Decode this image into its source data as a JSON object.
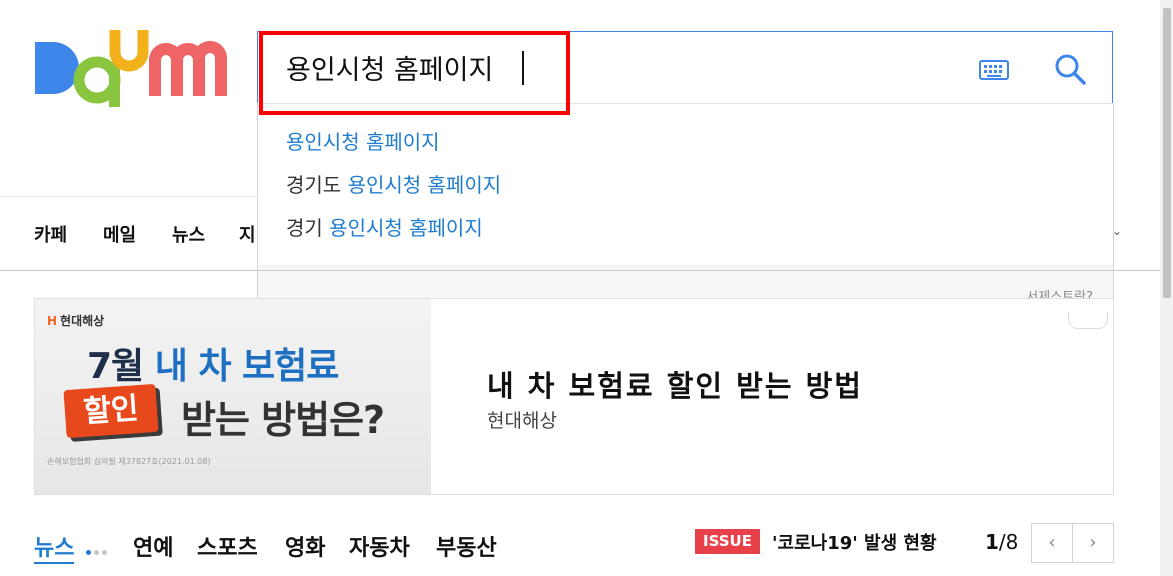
{
  "logo": {
    "text": "Daum",
    "colors": [
      "#3f86ea",
      "#f2b11b",
      "#8ac53f",
      "#f2b11b",
      "#ef6464"
    ]
  },
  "search": {
    "value": "용인시청 홈페이지",
    "keyboard_icon": "keyboard-icon",
    "search_icon": "magnifier-icon",
    "suggestions": [
      {
        "prefix": "",
        "match": "용인시청 홈페이지"
      },
      {
        "prefix": "경기도 ",
        "match": "용인시청 홈페이지"
      },
      {
        "prefix": "경기 ",
        "match": "용인시청 홈페이지"
      }
    ],
    "footer_link": "서제스트란?"
  },
  "nav": {
    "items": [
      "카페",
      "메일",
      "뉴스",
      "지"
    ],
    "more_icon": "chevron-down-icon"
  },
  "ad": {
    "brand": "현대해상",
    "headline_part1": "7월 ",
    "headline_part2": "내 차 보험료",
    "badge": "할인",
    "headline_line2": "받는 방법은?",
    "fine_print": "손해보험협회 심의필 제37827호(2021.01.08)",
    "title": "내 차 보험료 할인 받는 방법",
    "subtitle": "현대해상"
  },
  "news": {
    "tabs": [
      "뉴스",
      "연예",
      "스포츠",
      "영화",
      "자동차",
      "부동산"
    ],
    "issue_badge": "ISSUE",
    "issue_text": "'코로나19' 발생 현황",
    "page_current": "1",
    "page_total": "/8",
    "prev": "‹",
    "next": "›"
  },
  "colors": {
    "accent": "#1f7cd1",
    "search_border": "#3f86ea",
    "issue": "#e8414a",
    "highlight": "#ff0000"
  }
}
